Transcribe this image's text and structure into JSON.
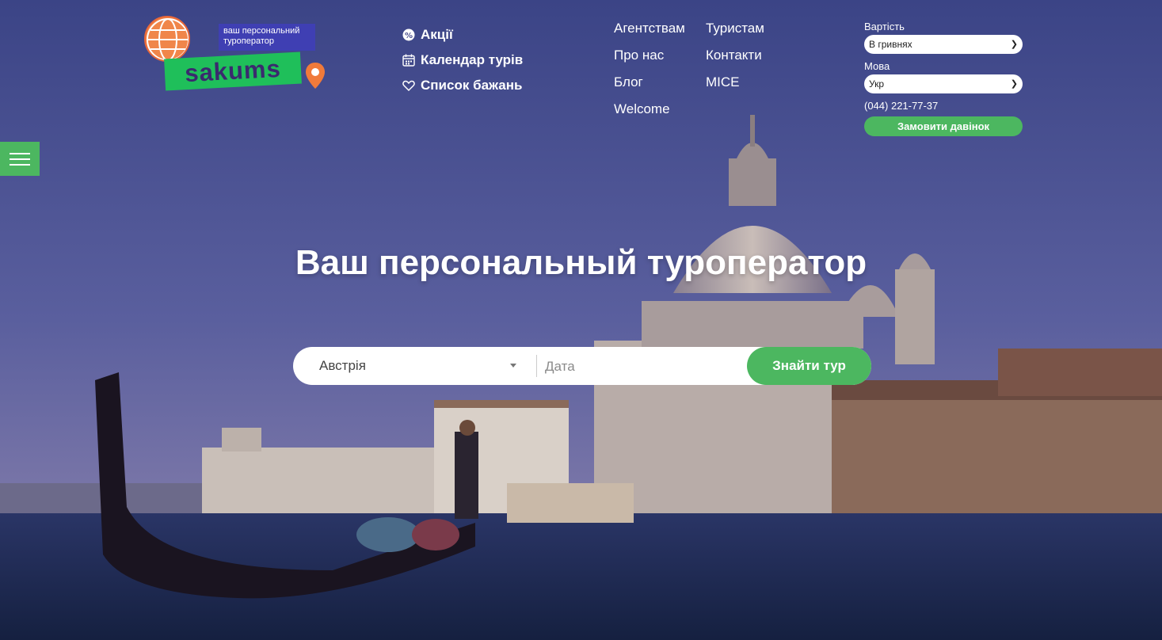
{
  "logo": {
    "tagline": "ваш персональний туроператор",
    "brand": "sakums",
    "colors": {
      "globe": "#f0864a",
      "tagline_bg": "#3f3fb3",
      "brand_bg": "#1fbf5a",
      "pin": "#f07a3a"
    }
  },
  "quick_links": [
    {
      "label": "Акції",
      "icon": "promo-badge-icon"
    },
    {
      "label": "Календар турів",
      "icon": "calendar-icon"
    },
    {
      "label": "Список бажань",
      "icon": "heart-icon"
    }
  ],
  "nav": {
    "col1": [
      "Агентствам",
      "Про нас",
      "Блог",
      "Welcome"
    ],
    "col2": [
      "Туристам",
      "Контакти",
      "MICE"
    ]
  },
  "panel": {
    "currency_label": "Вартість",
    "currency_value": "В гривнях",
    "language_label": "Мова",
    "language_value": "Укр",
    "phone": "(044) 221-77-37",
    "callback_label": "Замовити давінок"
  },
  "hero": {
    "headline": "Ваш персональный туроператор"
  },
  "search": {
    "country_value": "Австрія",
    "date_placeholder": "Дата",
    "submit_label": "Знайти тур"
  },
  "colors": {
    "accent": "#4cb760",
    "sky_top": "#3f4a8e",
    "water": "#1e2a50"
  },
  "icons": {
    "menu": "hamburger-icon"
  }
}
